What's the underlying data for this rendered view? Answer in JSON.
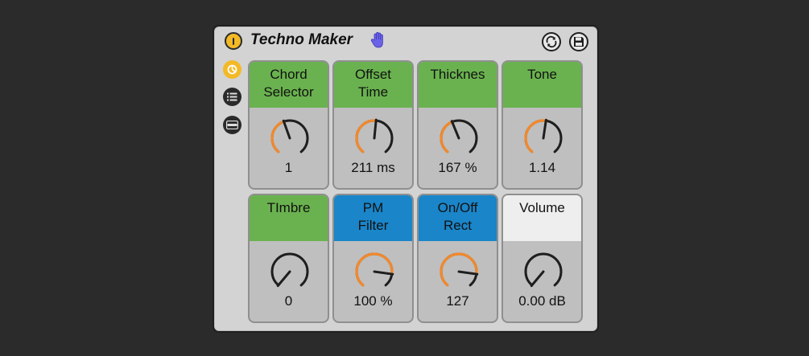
{
  "device": {
    "title": "Techno Maker",
    "icons": {
      "power": "power-icon",
      "hand": "hand-icon",
      "hotswap": "hotswap-icon",
      "save": "save-icon"
    },
    "side_icons": [
      "preset-icon",
      "list-icon",
      "device-view-icon"
    ]
  },
  "colors": {
    "background": "#2b2b2b",
    "device_bg": "#d3d3d3",
    "header_green": "#6ab24f",
    "header_blue": "#1a85c9",
    "header_white": "#eeeeee",
    "dial_arc": "#f2892c",
    "accent_yellow": "#f3b926"
  },
  "macros": [
    {
      "label": "Chord\nSelector",
      "value": "1",
      "header": "green",
      "level": 0.43
    },
    {
      "label": "Offset\nTime",
      "value": "211 ms",
      "header": "green",
      "level": 0.52
    },
    {
      "label": "Thicknes",
      "value": "167 %",
      "header": "green",
      "level": 0.42
    },
    {
      "label": "Tone",
      "value": "1.14",
      "header": "green",
      "level": 0.53
    },
    {
      "label": "TImbre",
      "value": "0",
      "header": "green",
      "level": 0.0
    },
    {
      "label": "PM\nFilter",
      "value": "100 %",
      "header": "blue",
      "level": 0.85
    },
    {
      "label": "On/Off\nRect",
      "value": "127",
      "header": "blue",
      "level": 0.85
    },
    {
      "label": "Volume",
      "value": "0.00 dB",
      "header": "white",
      "level": 0.0
    }
  ]
}
